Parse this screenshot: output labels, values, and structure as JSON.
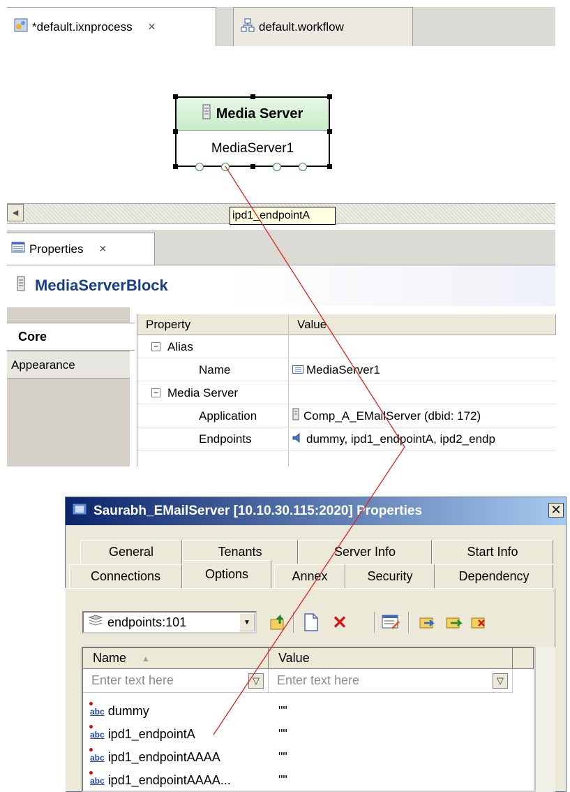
{
  "editor": {
    "tabs": [
      {
        "label": "*default.ixnprocess",
        "icon": "process-icon",
        "active": true
      },
      {
        "label": "default.workflow",
        "icon": "workflow-icon",
        "active": false
      }
    ]
  },
  "diagram": {
    "node": {
      "type_label": "Media Server",
      "instance_label": "MediaServer1"
    },
    "tooltip": "ipd1_endpointA"
  },
  "properties_view": {
    "tab_label": "Properties",
    "title": "MediaServerBlock",
    "side_tabs": [
      "Core",
      "Appearance"
    ],
    "columns": [
      "Property",
      "Value"
    ],
    "rows": [
      {
        "property": "Alias",
        "value": "",
        "group": true
      },
      {
        "property": "Name",
        "value": "MediaServer1",
        "group": false
      },
      {
        "property": "Media Server",
        "value": "",
        "group": true
      },
      {
        "property": "Application",
        "value": "Comp_A_EMailServer (dbid: 172)",
        "group": false
      },
      {
        "property": "Endpoints",
        "value": "dummy, ipd1_endpointA, ipd2_endp",
        "group": false
      }
    ]
  },
  "dialog": {
    "title": "Saurabh_EMailServer [10.10.30.115:2020] Properties",
    "tabs_row1": [
      "General",
      "Tenants",
      "Server Info",
      "Start Info"
    ],
    "tabs_row2": [
      "Connections",
      "Options",
      "Annex",
      "Security",
      "Dependency"
    ],
    "selected_tab": "Options",
    "section_combo": "endpoints:101",
    "list_columns": [
      "Name",
      "Value"
    ],
    "filter_placeholder": "Enter text here",
    "rows": [
      {
        "name": "dummy",
        "value": "\"\""
      },
      {
        "name": "ipd1_endpointA",
        "value": "\"\""
      },
      {
        "name": "ipd1_endpointAAAA",
        "value": "\"\""
      },
      {
        "name": "ipd1_endpointAAAA...",
        "value": "\"\""
      }
    ]
  },
  "colors": {
    "connector": "#e02020",
    "node_header": "#c8ecc8",
    "dialog_title_start": "#0a246a",
    "dialog_title_end": "#a6caf0"
  }
}
